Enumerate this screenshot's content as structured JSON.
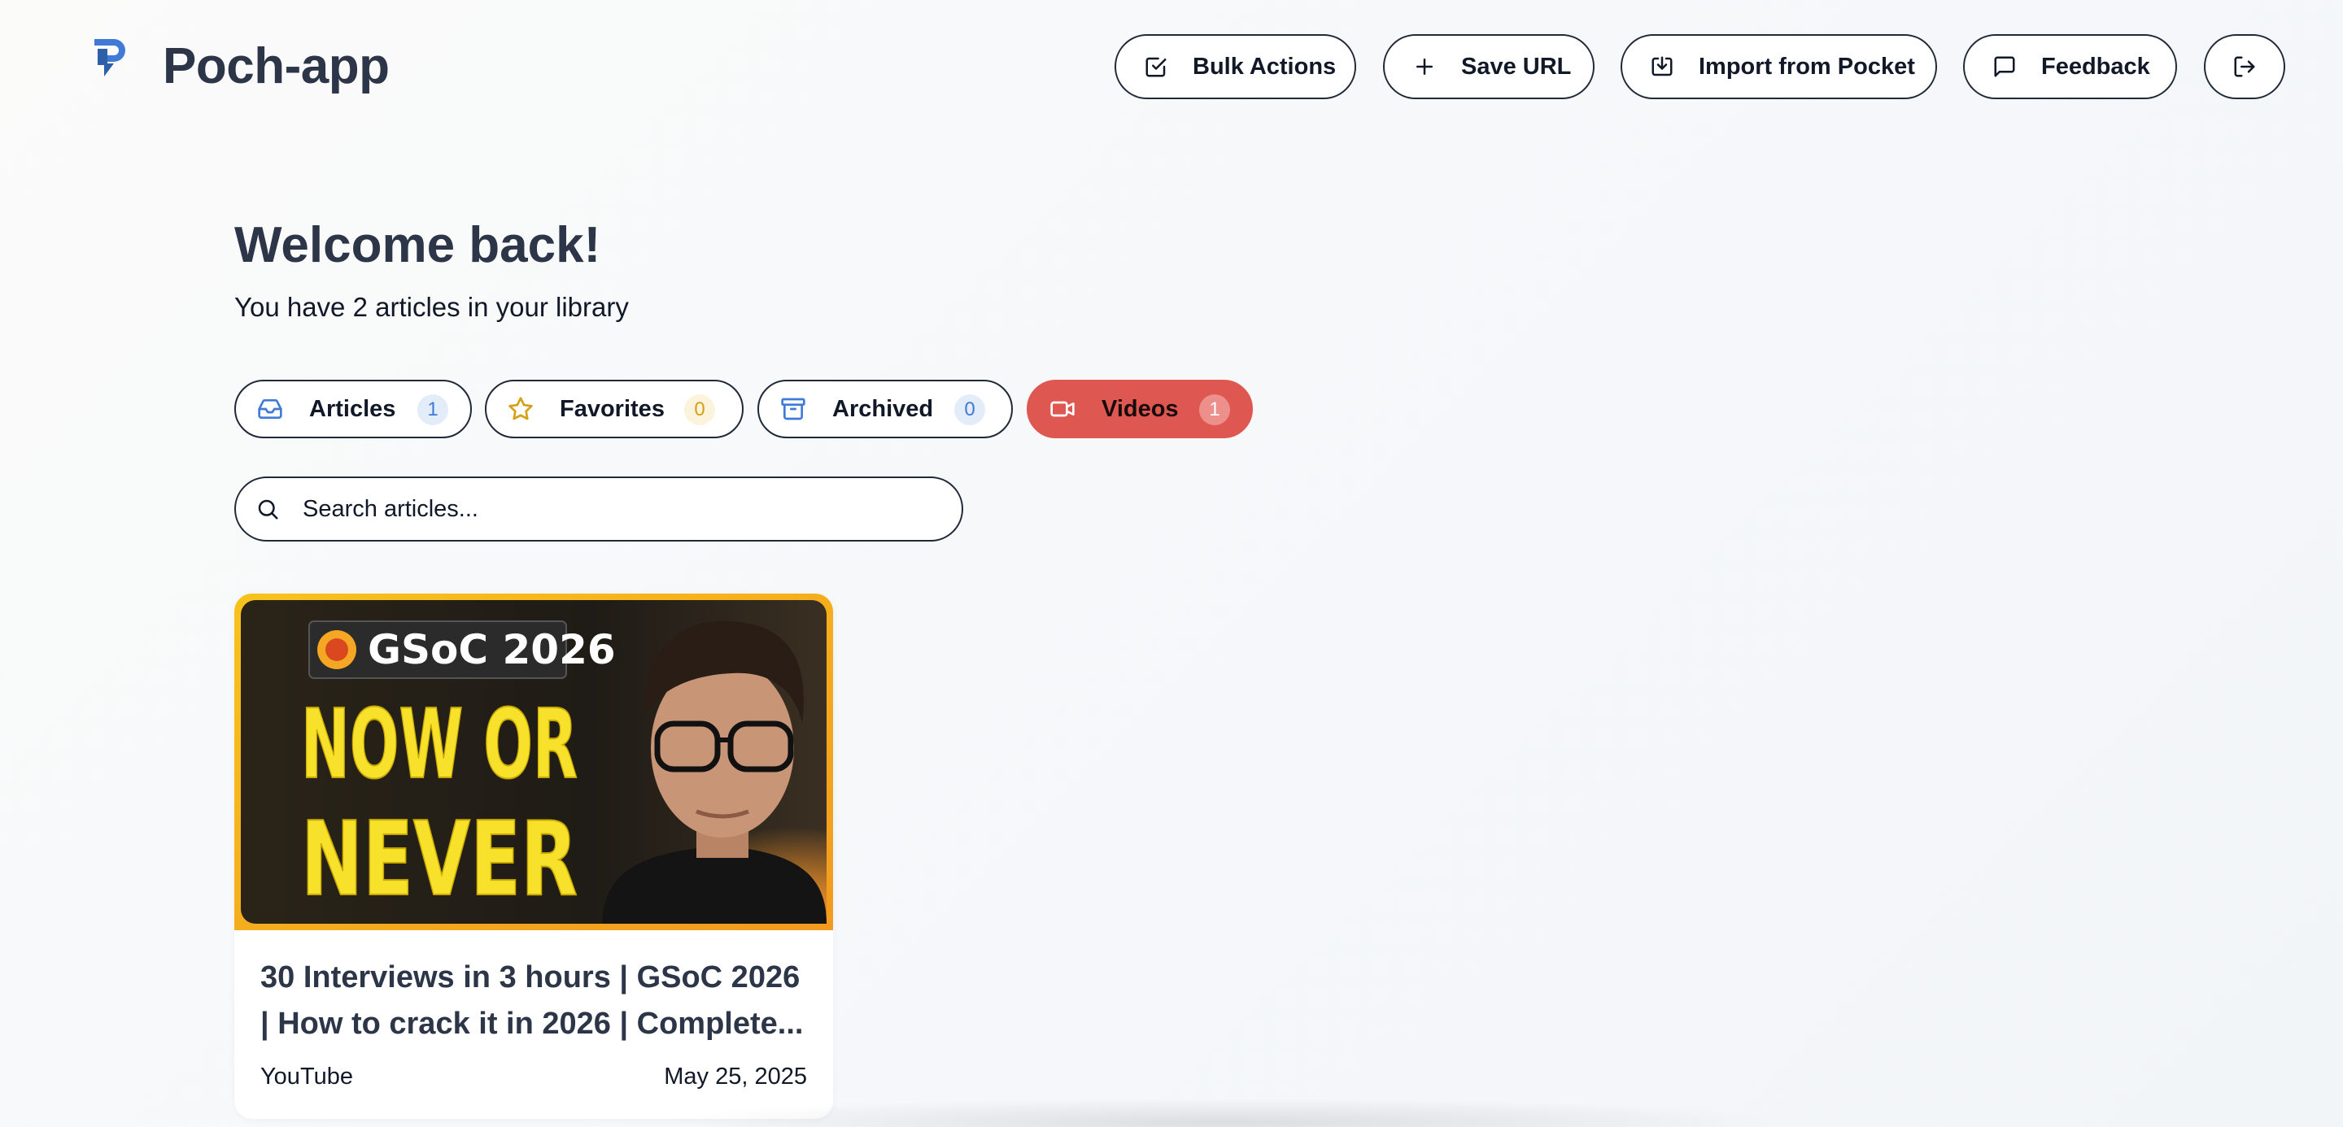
{
  "app": {
    "title": "Poch-app",
    "logo_icon": "poch-logo-icon"
  },
  "header": {
    "bulk_label": "Bulk Actions",
    "save_label": "Save URL",
    "import_label": "Import from Pocket",
    "feedback_label": "Feedback",
    "logout_icon": "logout-icon"
  },
  "main": {
    "heading": "Welcome back!",
    "subtitle": "You have 2 articles in your library"
  },
  "tabs": [
    {
      "label": "Articles",
      "count": "1",
      "icon": "inbox-icon",
      "active": false
    },
    {
      "label": "Favorites",
      "count": "0",
      "icon": "star-icon",
      "active": false
    },
    {
      "label": "Archived",
      "count": "0",
      "icon": "archive-icon",
      "active": false
    },
    {
      "label": "Videos",
      "count": "1",
      "icon": "video-icon",
      "active": true
    }
  ],
  "search": {
    "placeholder": "Search articles...",
    "value": ""
  },
  "cards": [
    {
      "title": "30 Interviews in 3 hours | GSoC 2026 | How to crack it in 2026 | Complete...",
      "source": "YouTube",
      "date": "May 25, 2025",
      "thumbnail": {
        "badge_text": "GSoC 2026",
        "headline_line1": "NOW OR",
        "headline_line2": "NEVER"
      }
    }
  ],
  "colors": {
    "text_dark": "#2d3648",
    "active_tab": "#df5751",
    "accent_blue": "#3f7bd6",
    "accent_yellow": "#d4a017"
  }
}
